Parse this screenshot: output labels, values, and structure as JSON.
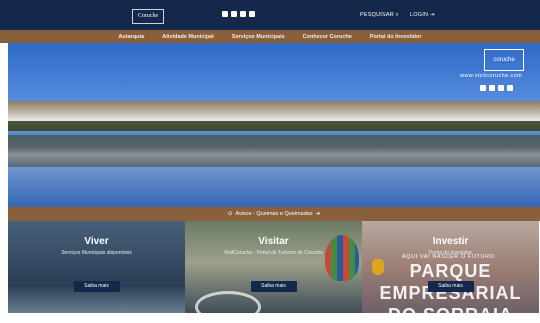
{
  "header": {
    "logo_text": "Coruche",
    "search_label": "PESQUISAR",
    "login_label": "LOGIN",
    "social_icons": [
      "facebook-icon",
      "instagram-icon",
      "twitter-icon",
      "youtube-icon"
    ]
  },
  "nav": {
    "items": [
      "Autarquia",
      "Atividade Municipal",
      "Serviços Municipais",
      "Conhecer Coruche",
      "Portal do Investidor"
    ]
  },
  "hero": {
    "logo_text": "coruche",
    "url": "www.visitcoruche.com",
    "social_icons": [
      "facebook-icon",
      "instagram-icon",
      "youtube-icon",
      "tripadvisor-icon"
    ],
    "slides": [
      {
        "active": true
      },
      {
        "active": false
      },
      {
        "active": false
      }
    ]
  },
  "alerts": {
    "label": "Avisos",
    "text": "Avisos - Queimas e Queimadas"
  },
  "cards": [
    {
      "title": "Viver",
      "subtitle": "Serviços Municipais disponíveis",
      "button": "Saiba mais"
    },
    {
      "title": "Visitar",
      "subtitle": "VisitCoruche - Portal de Turismo de Coruche",
      "button": "Saiba mais"
    },
    {
      "title": "Investir",
      "subtitle": "Portal do Investidor",
      "button": "Saiba mais",
      "overlay_slogan": "AQUI VAI NASCER O FUTURO",
      "overlay_lines": [
        "PARQUE",
        "EMPRESARIAL",
        "DO SORRAIA"
      ]
    }
  ],
  "colors": {
    "navy": "#13284a",
    "brown": "#8a5f3b",
    "white": "#ffffff"
  }
}
